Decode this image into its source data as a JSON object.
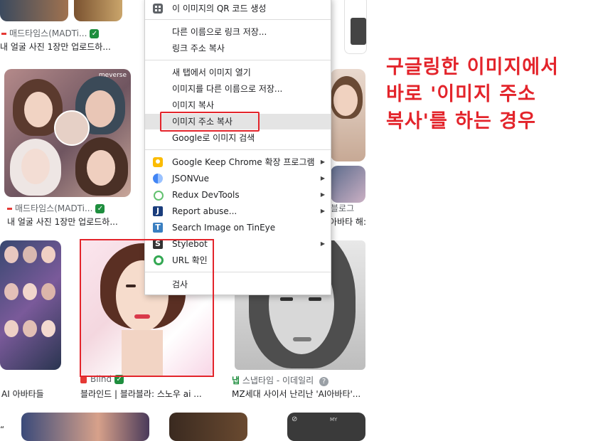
{
  "context_menu": {
    "items": [
      {
        "id": "qr",
        "label": "이 이미지의 QR 코드 생성",
        "icon": "qr-code-icon"
      },
      {
        "id": "save-link",
        "label": "다른 이름으로 링크 저장..."
      },
      {
        "id": "copy-link",
        "label": "링크 주소 복사"
      },
      {
        "id": "open-image-tab",
        "label": "새 탭에서 이미지 열기"
      },
      {
        "id": "save-image",
        "label": "이미지를 다른 이름으로 저장..."
      },
      {
        "id": "copy-image",
        "label": "이미지 복사"
      },
      {
        "id": "copy-image-address",
        "label": "이미지 주소 복사",
        "highlighted": true
      },
      {
        "id": "search-google",
        "label": "Google로 이미지 검색"
      },
      {
        "id": "keep",
        "label": "Google Keep Chrome 확장 프로그램",
        "icon": "google-keep-icon",
        "submenu": true
      },
      {
        "id": "jsonvue",
        "label": "JSONVue",
        "icon": "jsonvue-icon",
        "submenu": true
      },
      {
        "id": "redux",
        "label": "Redux DevTools",
        "icon": "redux-icon",
        "submenu": true
      },
      {
        "id": "report",
        "label": "Report abuse...",
        "icon": "report-abuse-icon",
        "submenu": true
      },
      {
        "id": "tineye",
        "label": "Search Image on TinEye",
        "icon": "tineye-icon"
      },
      {
        "id": "stylebot",
        "label": "Stylebot",
        "icon": "stylebot-icon",
        "submenu": true
      },
      {
        "id": "url-check",
        "label": "URL 확인",
        "icon": "url-check-icon"
      },
      {
        "id": "inspect",
        "label": "검사"
      }
    ]
  },
  "results": [
    {
      "source": "매드타임스(MADTi...",
      "title": "내 얼굴 사진 1장만 업로드하...",
      "verified": true
    },
    {
      "source": "매드타임스(MADTi...",
      "title": "내 얼굴 사진 1장만 업로드하...",
      "verified": true
    },
    {
      "source": "",
      "title": "AI 아바타들",
      "verified": false
    },
    {
      "source": "Blind",
      "title": "블라인드 | 블라블라: 스노우 ai ...",
      "verified": true
    },
    {
      "source": "스냅타임 - 이데일리",
      "title": "MZ세대 사이서 난리난 'AI아바타'...",
      "verified": false
    },
    {
      "source": "블로그",
      "title": "아바타 해:",
      "verified": false
    }
  ],
  "thumb_badge": "meverse",
  "partial_texts": {
    "left_edge_fragment": "“",
    "cut_label": "MY"
  },
  "annotation": "구글링한 이미지에서 바로 '이미지 주소 복사'를 하는 경우",
  "colors": {
    "annotation": "#e3242b",
    "highlight": "#e4e4e4",
    "verified": "#1e8e3e"
  }
}
